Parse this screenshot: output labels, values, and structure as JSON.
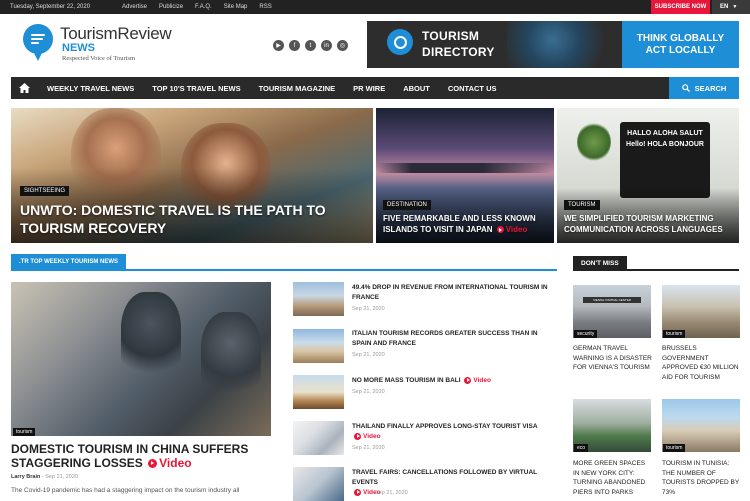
{
  "topbar": {
    "date": "Tuesday, September 22, 2020",
    "links": [
      "Advertise",
      "Publicize",
      "F.A.Q.",
      "Site Map",
      "RSS"
    ],
    "subscribe": "SUBSCRIBE NOW",
    "lang": "EN"
  },
  "logo": {
    "name": "TourismReview",
    "sub": "NEWS",
    "tagline": "Respected Voice of Tourism"
  },
  "social": [
    "youtube-icon",
    "facebook-icon",
    "twitter-icon",
    "linkedin-icon",
    "instagram-icon"
  ],
  "banner": {
    "line1": "TOURISM",
    "line2": "DIRECTORY",
    "right1": "THINK GLOBALLY",
    "right2": "ACT LOCALLY"
  },
  "nav": {
    "items": [
      "WEEKLY TRAVEL NEWS",
      "TOP 10'S TRAVEL NEWS",
      "TOURISM MAGAZINE",
      "PR WIRE",
      "ABOUT",
      "CONTACT US"
    ],
    "search": "SEARCH"
  },
  "hero": {
    "big": {
      "cat": "SIGHTSEEING",
      "title": "UNWTO: DOMESTIC TRAVEL IS THE PATH TO TOURISM RECOVERY"
    },
    "mid": {
      "cat": "DESTINATION",
      "title": "FIVE REMARKABLE AND LESS KNOWN ISLANDS TO VISIT IN JAPAN",
      "video": "Video"
    },
    "right": {
      "cat": "TOURISM",
      "title": "WE SIMPLIFIED TOURISM MARKETING COMMUNICATION ACROSS LANGUAGES",
      "words": "HALLO ALOHA SALUT Hello! HOLA BONJOUR"
    }
  },
  "top_weekly": {
    "tab": ".TR TOP WEEKLY TOURISM NEWS",
    "main": {
      "cat": "tourism",
      "title": "DOMESTIC TOURISM IN CHINA SUFFERS STAGGERING LOSSES",
      "video": "Video",
      "author": "Larry Brain",
      "date": "Sep 21, 2020",
      "excerpt": "The Covid-19 pandemic has had a staggering impact on the tourism industry all"
    },
    "list": [
      {
        "title": "49.4% DROP IN REVENUE FROM INTERNATIONAL TOURISM IN FRANCE",
        "date": "Sep 21, 2020",
        "video": ""
      },
      {
        "title": "ITALIAN TOURISM RECORDS GREATER SUCCESS THAN IN SPAIN AND FRANCE",
        "date": "Sep 21, 2020",
        "video": ""
      },
      {
        "title": "NO MORE MASS TOURISM IN BALI",
        "date": "Sep 21, 2020",
        "video": "Video"
      },
      {
        "title": "THAILAND FINALLY APPROVES LONG-STAY TOURIST VISA",
        "date": "Sep 21, 2020",
        "video": "Video"
      },
      {
        "title": "TRAVEL FAIRS: CANCELLATIONS FOLLOWED BY VIRTUAL EVENTS",
        "date": "Sep 21, 2020",
        "video": "Video"
      }
    ]
  },
  "dont_miss": {
    "tab": "DON'T MISS",
    "items": [
      {
        "cat": "security",
        "title": "GERMAN TRAVEL WARNING IS A DISASTER FOR VIENNA'S TOURISM",
        "sign": "VIENNA VISITING CENTER"
      },
      {
        "cat": "tourism",
        "title": "BRUSSELS GOVERNMENT APPROVED €30 MILLION AID FOR TOURISM"
      },
      {
        "cat": "eco",
        "title": "MORE GREEN SPACES IN NEW YORK CITY: TURNING ABANDONED PIERS INTO PARKS"
      },
      {
        "cat": "tourism",
        "title": "TOURISM IN TUNISIA: THE NUMBER OF TOURISTS DROPPED BY 73%"
      }
    ]
  },
  "colors": {
    "accent": "#1e8fd6",
    "red": "#e8163a",
    "dark": "#222222"
  }
}
